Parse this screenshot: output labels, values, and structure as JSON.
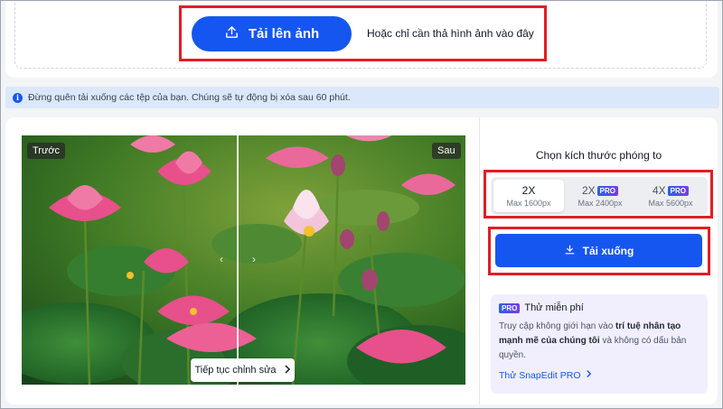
{
  "upload": {
    "button_label": "Tải lên ảnh",
    "hint": "Hoặc chỉ cần thả hình ảnh vào đây",
    "icon": "upload-icon"
  },
  "notice": {
    "icon": "info-icon",
    "icon_glyph": "i",
    "text": "Đừng quên tải xuống các tệp của bạn. Chúng sẽ tự động bị xóa sau 60 phút."
  },
  "preview": {
    "before_label": "Trước",
    "after_label": "Sau",
    "continue_label": "Tiếp tục chỉnh sửa",
    "continue_icon": "chevron-right-icon"
  },
  "panel": {
    "title": "Chọn kích thước phóng to",
    "scale_options": [
      {
        "label": "2X",
        "sub": "Max 1600px",
        "pro": "",
        "selected": true
      },
      {
        "label": "2X",
        "sub": "Max 2400px",
        "pro": "PRO",
        "selected": false
      },
      {
        "label": "4X",
        "sub": "Max 5600px",
        "pro": "PRO",
        "selected": false
      }
    ],
    "download_label": "Tải xuống",
    "download_icon": "download-icon"
  },
  "pro_card": {
    "badge": "PRO",
    "title": "Thử miễn phí",
    "desc_part1": "Truy cập không giới hạn vào ",
    "desc_bold": "trí tuệ nhân tạo mạnh mẽ của chúng tôi",
    "desc_part2": " và không có dấu bản quyền.",
    "link_label": "Thử SnapEdit PRO",
    "link_icon": "chevron-right-icon"
  },
  "colors": {
    "accent": "#1556f0",
    "highlight": "#e11d24",
    "notice_bg": "#dbe8fb",
    "pro_card_bg": "#f1effd"
  }
}
